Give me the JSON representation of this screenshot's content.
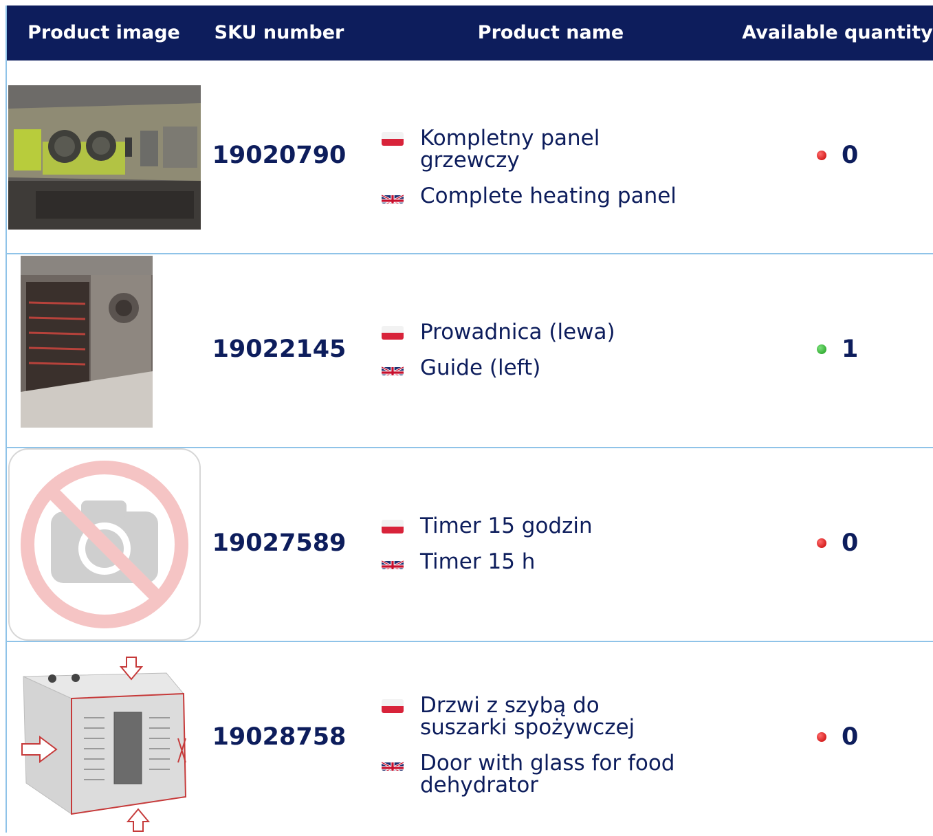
{
  "table": {
    "headers": {
      "image": "Product image",
      "sku": "SKU number",
      "name": "Product name",
      "quantity": "Available quantity"
    },
    "rows": [
      {
        "sku": "19020790",
        "name_pl": "Kompletny panel grzewczy",
        "name_en": "Complete heating panel",
        "quantity": "0",
        "status": "out-of-stock",
        "image": "heating-panel-photo"
      },
      {
        "sku": "19022145",
        "name_pl": "Prowadnica (lewa)",
        "name_en": "Guide (left)",
        "quantity": "1",
        "status": "in-stock",
        "image": "dehydrator-interior-photo"
      },
      {
        "sku": "19027589",
        "name_pl": "Timer 15 godzin",
        "name_en": "Timer 15 h",
        "quantity": "0",
        "status": "out-of-stock",
        "image": "no-photo-icon"
      },
      {
        "sku": "19028758",
        "name_pl": "Drzwi z szybą do suszarki spożywczej",
        "name_en": "Door with glass for food dehydrator",
        "quantity": "0",
        "status": "out-of-stock",
        "image": "dehydrator-door-diagram"
      }
    ]
  },
  "colors": {
    "header_bg": "#0d1d5c",
    "text": "#0d1d5c",
    "border": "#8fc3e8",
    "status_red": "#d40000",
    "status_green": "#22aa22"
  }
}
